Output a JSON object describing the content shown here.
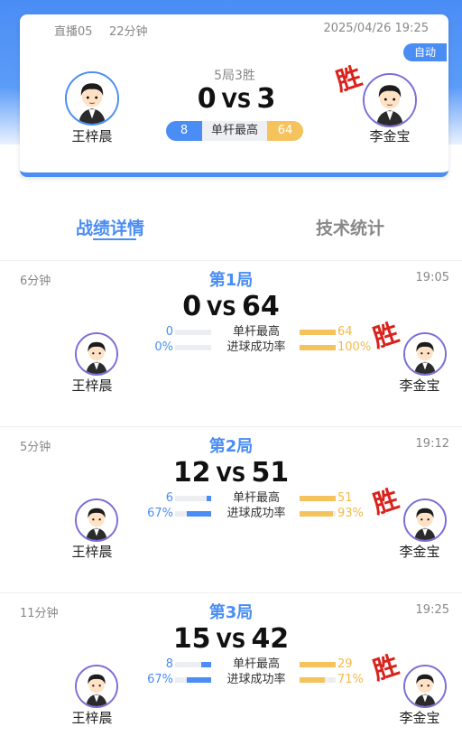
{
  "header": {
    "channel": "直播05",
    "duration": "22分钟",
    "datetime": "2025/04/26 19:25",
    "auto_label": "自动",
    "format": "5局3胜",
    "score_left": "0",
    "vs": "VS",
    "score_right": "3",
    "highest_label": "单杆最高",
    "highest_left": "8",
    "highest_right": "64",
    "win_label": "胜",
    "player_left": "王梓晨",
    "player_right": "李金宝"
  },
  "tabs": [
    {
      "label": "战绩详情",
      "active": true
    },
    {
      "label": "技术统计",
      "active": false
    }
  ],
  "games": [
    {
      "duration": "6分钟",
      "title": "第1局",
      "time": "19:05",
      "score_left": "0",
      "vs": "VS",
      "score_right": "64",
      "stats": [
        {
          "label": "单杆最高",
          "left": "0",
          "right": "64",
          "left_frac": 0.0,
          "right_frac": 1.0
        },
        {
          "label": "进球成功率",
          "left": "0%",
          "right": "100%",
          "left_frac": 0.0,
          "right_frac": 1.0
        }
      ],
      "player_left": "王梓晨",
      "player_right": "李金宝",
      "win_label": "胜"
    },
    {
      "duration": "5分钟",
      "title": "第2局",
      "time": "19:12",
      "score_left": "12",
      "vs": "VS",
      "score_right": "51",
      "stats": [
        {
          "label": "单杆最高",
          "left": "6",
          "right": "51",
          "left_frac": 0.12,
          "right_frac": 1.0
        },
        {
          "label": "进球成功率",
          "left": "67%",
          "right": "93%",
          "left_frac": 0.67,
          "right_frac": 0.93
        }
      ],
      "player_left": "王梓晨",
      "player_right": "李金宝",
      "win_label": "胜"
    },
    {
      "duration": "11分钟",
      "title": "第3局",
      "time": "19:25",
      "score_left": "15",
      "vs": "VS",
      "score_right": "42",
      "stats": [
        {
          "label": "单杆最高",
          "left": "8",
          "right": "29",
          "left_frac": 0.28,
          "right_frac": 1.0
        },
        {
          "label": "进球成功率",
          "left": "67%",
          "right": "71%",
          "left_frac": 0.67,
          "right_frac": 0.71
        }
      ],
      "player_left": "王梓晨",
      "player_right": "李金宝",
      "win_label": "胜"
    }
  ],
  "colors": {
    "primary": "#4a8df5",
    "gold": "#f5c35e",
    "win": "#d9221c"
  },
  "icons": {
    "avatar": "cartoon-player-avatar-icon"
  }
}
